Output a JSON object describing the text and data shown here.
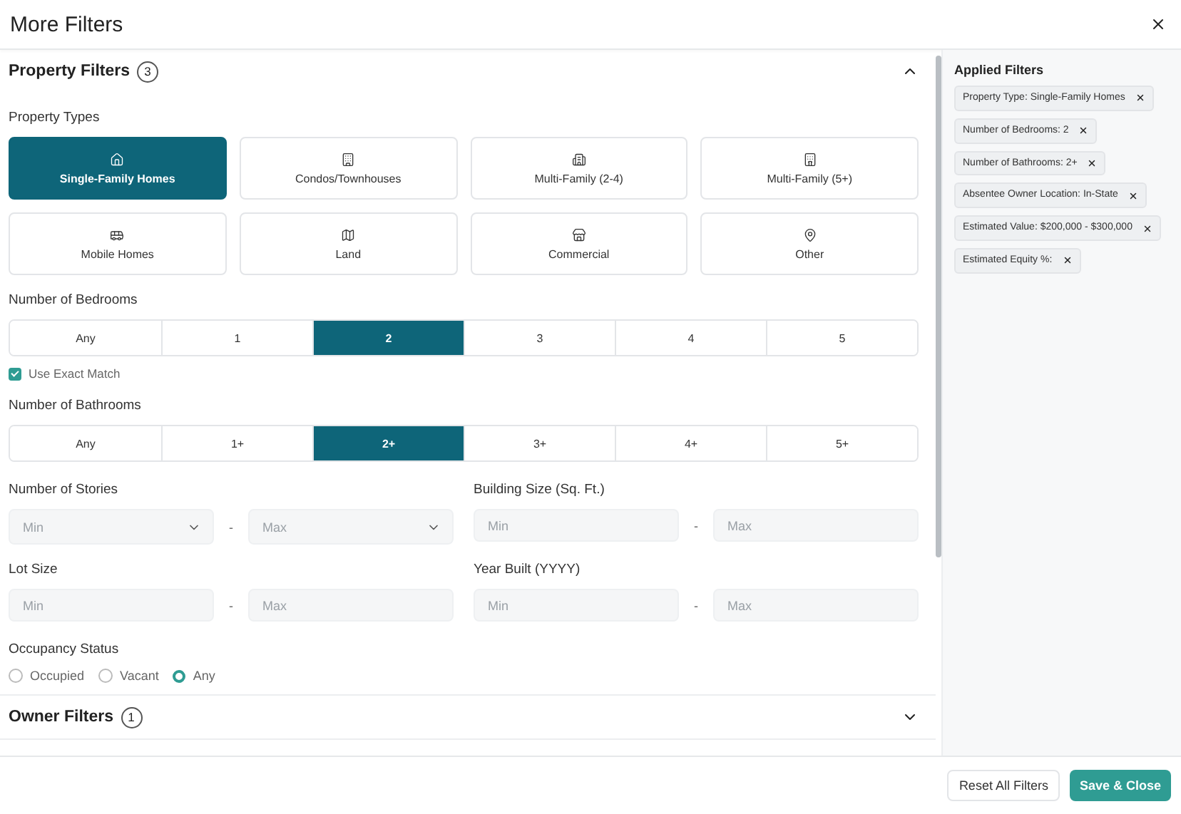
{
  "title": "More Filters",
  "property_section": {
    "title": "Property Filters",
    "count": "3",
    "expanded": true
  },
  "property_types": {
    "label": "Property Types",
    "options": [
      {
        "label": "Single-Family Homes",
        "selected": true
      },
      {
        "label": "Condos/Townhouses",
        "selected": false
      },
      {
        "label": "Multi-Family (2-4)",
        "selected": false
      },
      {
        "label": "Multi-Family (5+)",
        "selected": false
      },
      {
        "label": "Mobile Homes",
        "selected": false
      },
      {
        "label": "Land",
        "selected": false
      },
      {
        "label": "Commercial",
        "selected": false
      },
      {
        "label": "Other",
        "selected": false
      }
    ]
  },
  "bedrooms": {
    "label": "Number of Bedrooms",
    "options": [
      {
        "label": "Any",
        "selected": false
      },
      {
        "label": "1",
        "selected": false
      },
      {
        "label": "2",
        "selected": true
      },
      {
        "label": "3",
        "selected": false
      },
      {
        "label": "4",
        "selected": false
      },
      {
        "label": "5",
        "selected": false
      }
    ],
    "exact_match": {
      "label": "Use Exact Match",
      "checked": true
    }
  },
  "bathrooms": {
    "label": "Number of Bathrooms",
    "options": [
      {
        "label": "Any",
        "selected": false
      },
      {
        "label": "1+",
        "selected": false
      },
      {
        "label": "2+",
        "selected": true
      },
      {
        "label": "3+",
        "selected": false
      },
      {
        "label": "4+",
        "selected": false
      },
      {
        "label": "5+",
        "selected": false
      }
    ]
  },
  "ranges": [
    {
      "label": "Number of Stories",
      "kind": "select",
      "min": "Min",
      "separator": "-",
      "max": "Max"
    },
    {
      "label": "Building Size (Sq. Ft.)",
      "kind": "input",
      "min_placeholder": "Min",
      "separator": "-",
      "max_placeholder": "Max"
    },
    {
      "label": "Lot Size",
      "kind": "input",
      "min_placeholder": "Min",
      "separator": "-",
      "max_placeholder": "Max"
    },
    {
      "label": "Year Built (YYYY)",
      "kind": "input",
      "min_placeholder": "Min",
      "separator": "-",
      "max_placeholder": "Max"
    }
  ],
  "occupancy": {
    "label": "Occupancy Status",
    "options": [
      {
        "label": "Occupied",
        "selected": false
      },
      {
        "label": "Vacant",
        "selected": false
      },
      {
        "label": "Any",
        "selected": true
      }
    ]
  },
  "owner_section": {
    "title": "Owner Filters",
    "count": "1",
    "expanded": false
  },
  "applied_filters": {
    "title": "Applied Filters",
    "items": [
      "Property Type: Single-Family Homes",
      "Number of Bedrooms: 2",
      "Number of Bathrooms: 2+",
      "Absentee Owner Location: In-State",
      "Estimated Value: $200,000 - $300,000",
      "Estimated Equity %:"
    ]
  },
  "buttons": {
    "reset": "Reset All Filters",
    "save": "Save & Close"
  }
}
